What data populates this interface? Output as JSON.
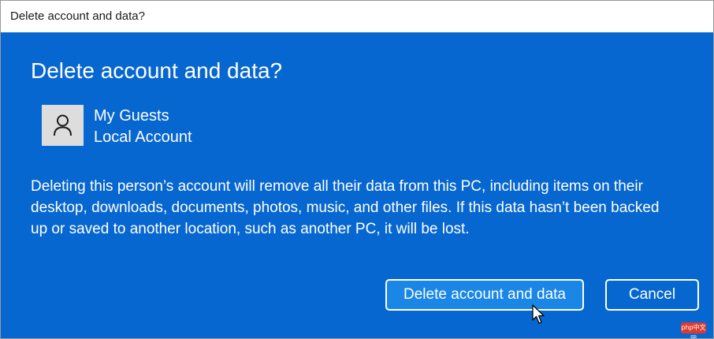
{
  "window": {
    "title": "Delete account and data?"
  },
  "dialog": {
    "heading": "Delete account and data?",
    "account": {
      "name": "My Guests",
      "type": "Local Account",
      "avatar_icon": "person-icon"
    },
    "description": "Deleting this person’s account will remove all their data from this PC, including items on their desktop, downloads, documents, photos, music, and other files. If this data hasn’t been backed up or saved to another location, such as another PC, it will be lost.",
    "buttons": {
      "delete_label": "Delete account and data",
      "cancel_label": "Cancel"
    }
  },
  "watermark": {
    "text": "php中文网"
  },
  "colors": {
    "dialog_background": "#0767d1",
    "primary_button": "#1a86e6",
    "text": "#ffffff",
    "watermark": "#e03a2f"
  }
}
